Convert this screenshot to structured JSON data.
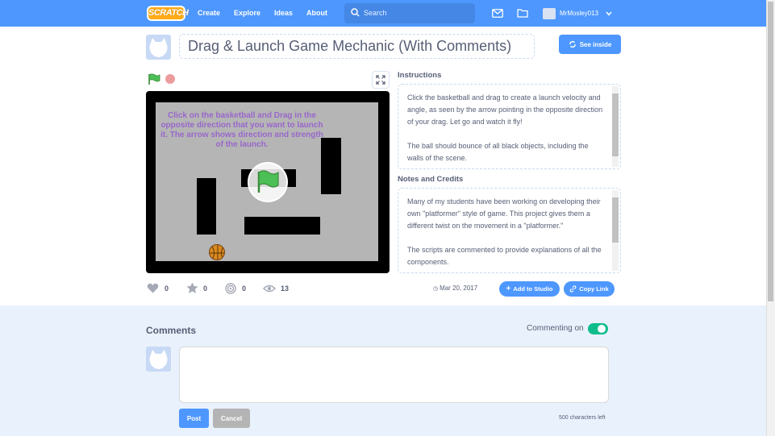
{
  "nav": {
    "logo": "SCRATCH",
    "links": [
      "Create",
      "Explore",
      "Ideas",
      "About"
    ],
    "search_placeholder": "Search",
    "username": "MrMosley013"
  },
  "project": {
    "title": "Drag & Launch Game Mechanic (With Comments)",
    "see_inside": "See inside",
    "stage_text": "Click on the basketball and Drag in the opposite direction that you want to launch it.  The arrow shows direction and strength of the launch."
  },
  "instructions": {
    "heading": "Instructions",
    "text": "Click the basketball and drag to create a launch velocity and angle, as seen by the arrow pointing in the opposite direction of your drag.  Let go and watch it fly!\n\nThe ball should bounce of all black objects, including the walls of the scene."
  },
  "notes": {
    "heading": "Notes and Credits",
    "text": "Many of my students have been working on developing their own \"platformer\" style of game.  This project gives them a different twist on the movement in a \"platformer.\"\n\nThe scripts are commented to provide explanations of all the components."
  },
  "stats": {
    "loves": "0",
    "favorites": "0",
    "remixes": "0",
    "views": "13",
    "date": "Mar 20, 2017",
    "add_to_studio": "Add to Studio",
    "copy_link": "Copy Link"
  },
  "comments": {
    "title": "Comments",
    "commenting_label": "Commenting on",
    "post": "Post",
    "cancel": "Cancel",
    "chars_left": "500 characters left"
  },
  "colors": {
    "brand_blue": "#4d97ff",
    "toggle_green": "#0fbd8c",
    "stage_text_purple": "#9966cc"
  }
}
